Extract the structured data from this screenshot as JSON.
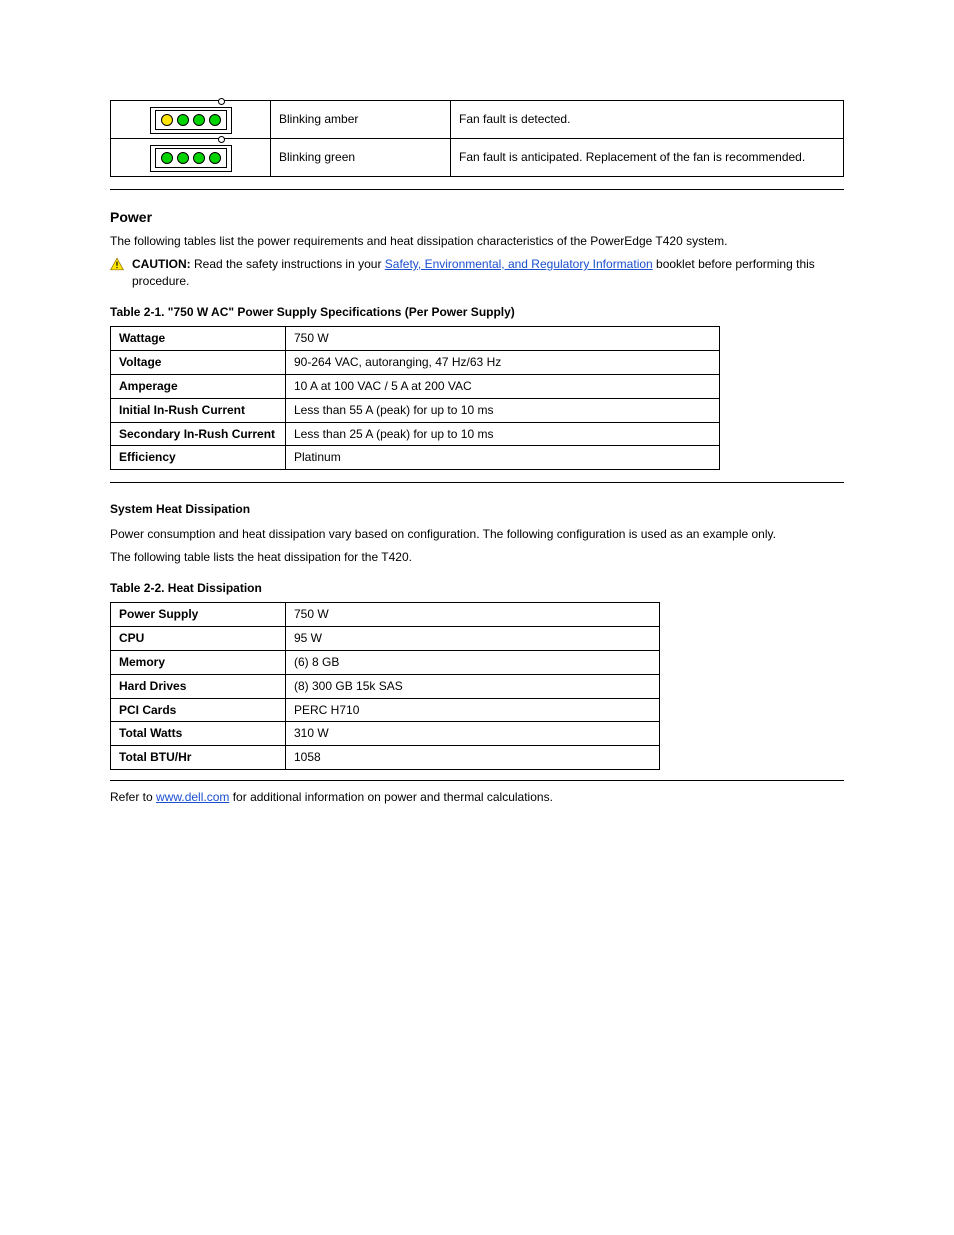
{
  "status_table": {
    "rows": [
      {
        "led_colors": [
          "yellow",
          "green",
          "green",
          "green"
        ],
        "state": "Blinking amber",
        "desc": "Fan fault is detected."
      },
      {
        "led_colors": [
          "green",
          "green",
          "green",
          "green"
        ],
        "state": "Blinking green",
        "desc": "Fan fault is anticipated. Replacement of the fan is recommended."
      }
    ]
  },
  "power_section": {
    "title": "Power",
    "intro": "The following tables list the power requirements and heat dissipation characteristics of the PowerEdge T420 system.",
    "caution_label": "CAUTION:",
    "caution_text_before": " Read the safety instructions in your ",
    "caution_link": "Safety, Environmental, and Regulatory Information",
    "caution_text_after": " booklet before performing this procedure."
  },
  "table_21": {
    "caption": "Table 2-1. \"750 W AC\" Power Supply Specifications (Per Power Supply)",
    "rows": [
      {
        "attr": "Wattage",
        "val": "750 W"
      },
      {
        "attr": "Voltage",
        "val": "90-264 VAC, autoranging, 47 Hz/63 Hz"
      },
      {
        "attr": "Amperage",
        "val": "10 A at 100 VAC / 5 A at 200 VAC"
      },
      {
        "attr": "Initial In-Rush Current",
        "val": "Less than 55 A (peak) for up to 10 ms"
      },
      {
        "attr": "Secondary In-Rush Current",
        "val": "Less than 25 A (peak) for up to 10 ms"
      },
      {
        "attr": "Efficiency",
        "val": "Platinum"
      }
    ]
  },
  "heat_section": {
    "title": "System Heat Dissipation",
    "p1": "Power consumption and heat dissipation vary based on configuration. The following configuration is used as an example only.",
    "p2": "The following table lists the heat dissipation for the T420."
  },
  "table_22": {
    "caption": "Table 2-2. Heat Dissipation",
    "rows": [
      {
        "attr": "Power Supply",
        "val": "750 W"
      },
      {
        "attr": "CPU",
        "val": "95 W"
      },
      {
        "attr": "Memory",
        "val": "(6) 8 GB"
      },
      {
        "attr": "Hard Drives",
        "val": "(8) 300 GB 15k SAS"
      },
      {
        "attr": "PCI Cards",
        "val": "PERC H710"
      },
      {
        "attr": "Total Watts",
        "val": "310 W"
      },
      {
        "attr": "Total BTU/Hr",
        "val": "1058"
      }
    ]
  },
  "refer_text_before": "Refer to ",
  "refer_link": "www.dell.com",
  "refer_text_after": " for additional information on power and thermal calculations."
}
